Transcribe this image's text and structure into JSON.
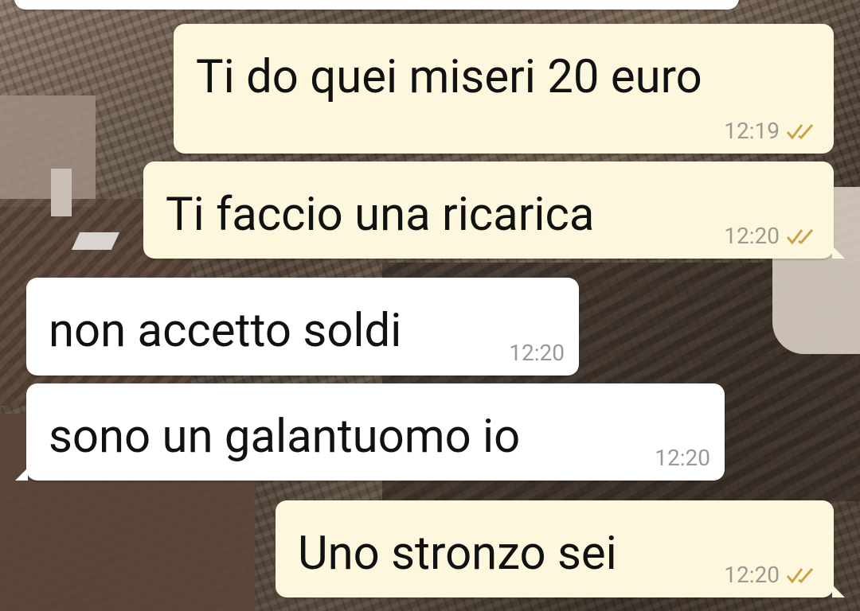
{
  "messages": [
    {
      "text": "Ti do quei miseri 20 euro",
      "time": "12:19",
      "direction": "outgoing",
      "status": "read"
    },
    {
      "text": "Ti faccio una ricarica",
      "time": "12:20",
      "direction": "outgoing",
      "status": "read"
    },
    {
      "text": "non accetto soldi",
      "time": "12:20",
      "direction": "incoming"
    },
    {
      "text": "sono un galantuomo io",
      "time": "12:20",
      "direction": "incoming"
    },
    {
      "text": "Uno stronzo sei",
      "time": "12:20",
      "direction": "outgoing",
      "status": "read"
    }
  ],
  "colors": {
    "outgoing_bubble": "#fdf8dd",
    "incoming_bubble": "#ffffff",
    "read_tick": "#c9a24a",
    "timestamp": "#9a9a93"
  },
  "icons": {
    "read_status": "double-check-icon"
  }
}
